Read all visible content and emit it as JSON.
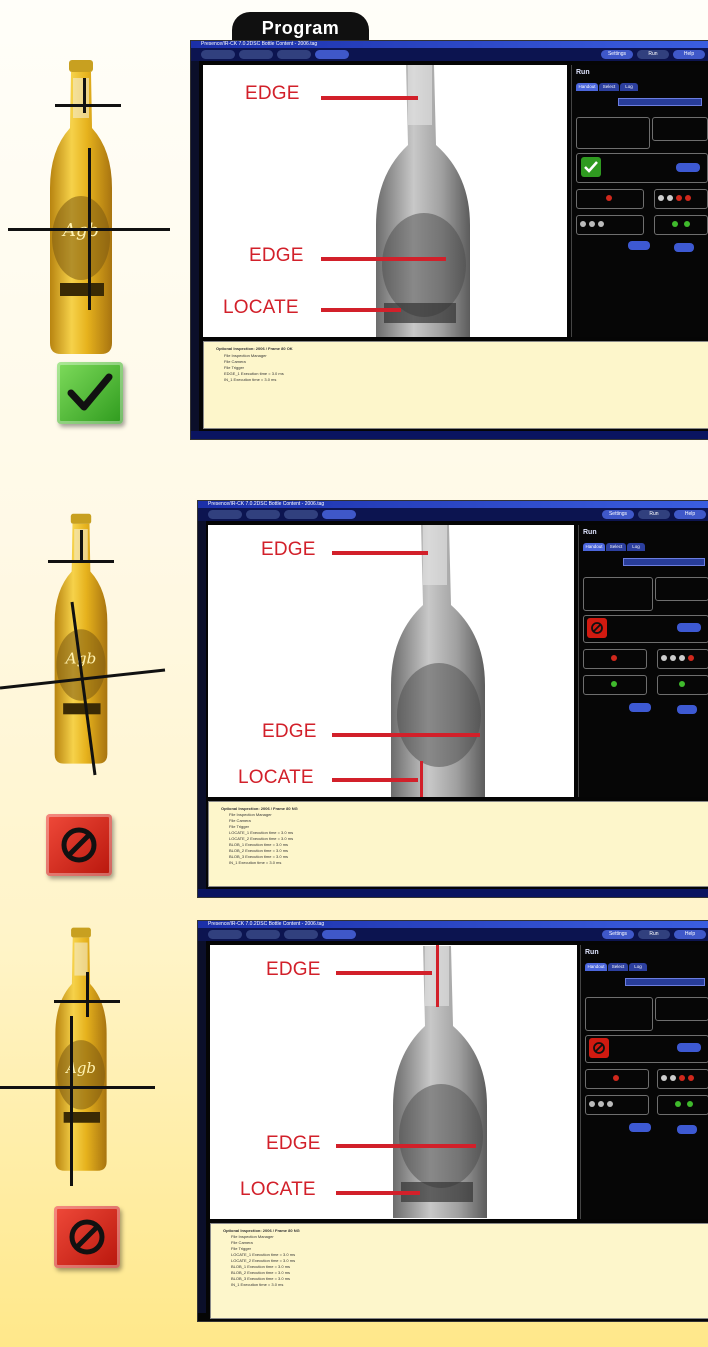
{
  "program_tab": "Program",
  "panels": [
    {
      "result": "pass",
      "result_icon": "checkmark-icon",
      "annotations": [
        "EDGE",
        "EDGE",
        "LOCATE"
      ],
      "window": {
        "title": "Presence/IR-CK 7.0.2DSC Bottle Content - 2006.tag",
        "toolbar_right": [
          "Settings",
          "Run",
          "Help"
        ],
        "run_title": "Run",
        "tabs": [
          "Handout",
          "Select",
          "Log"
        ],
        "tree": [
          "Optional Inspection: 2006 / Frame 80 OK",
          "File Inspection Manager",
          "File Camera",
          "File Trigger",
          "EDGE_1 Execution time = 3.0 ms",
          "IN_1 Execution time = 3.0 ms"
        ]
      }
    },
    {
      "result": "fail",
      "result_icon": "no-entry-icon",
      "annotations": [
        "EDGE",
        "EDGE",
        "LOCATE"
      ],
      "window": {
        "title": "Presence/IR-CK 7.0.2DSC Bottle Content - 2006.tag",
        "toolbar_right": [
          "Settings",
          "Run",
          "Help"
        ],
        "run_title": "Run",
        "tabs": [
          "Handout",
          "Select",
          "Log"
        ],
        "tree": [
          "Optional Inspection: 2006 / Frame 80 NG",
          "File Inspection Manager",
          "File Camera",
          "File Trigger",
          "LOCATE_1 Execution time = 3.0 ms",
          "LOCATE_2 Execution time = 3.0 ms",
          "BLOB_1 Execution time = 3.0 ms",
          "BLOB_2 Execution time = 3.0 ms",
          "BLOB_3 Execution time = 3.0 ms",
          "IN_1 Execution time = 3.0 ms"
        ]
      }
    },
    {
      "result": "fail",
      "result_icon": "no-entry-icon",
      "annotations": [
        "EDGE",
        "EDGE",
        "LOCATE"
      ],
      "window": {
        "title": "Presence/IR-CK 7.0.2DSC Bottle Content - 2006.tag",
        "toolbar_right": [
          "Settings",
          "Run",
          "Help"
        ],
        "run_title": "Run",
        "tabs": [
          "Handout",
          "Select",
          "Log"
        ],
        "tree": [
          "Optional Inspection: 2006 / Frame 80 NG",
          "File Inspection Manager",
          "File Camera",
          "File Trigger",
          "LOCATE_1 Execution time = 3.0 ms",
          "LOCATE_2 Execution time = 3.0 ms",
          "BLOB_1 Execution time = 3.0 ms",
          "BLOB_2 Execution time = 3.0 ms",
          "BLOB_3 Execution time = 3.0 ms",
          "IN_1 Execution time = 3.0 ms"
        ]
      }
    }
  ],
  "colors": {
    "annotation_red": "#d2202a",
    "pass_green": "#2e9a1d",
    "fail_red": "#c4170c",
    "window_blue": "#1b2fa8"
  }
}
